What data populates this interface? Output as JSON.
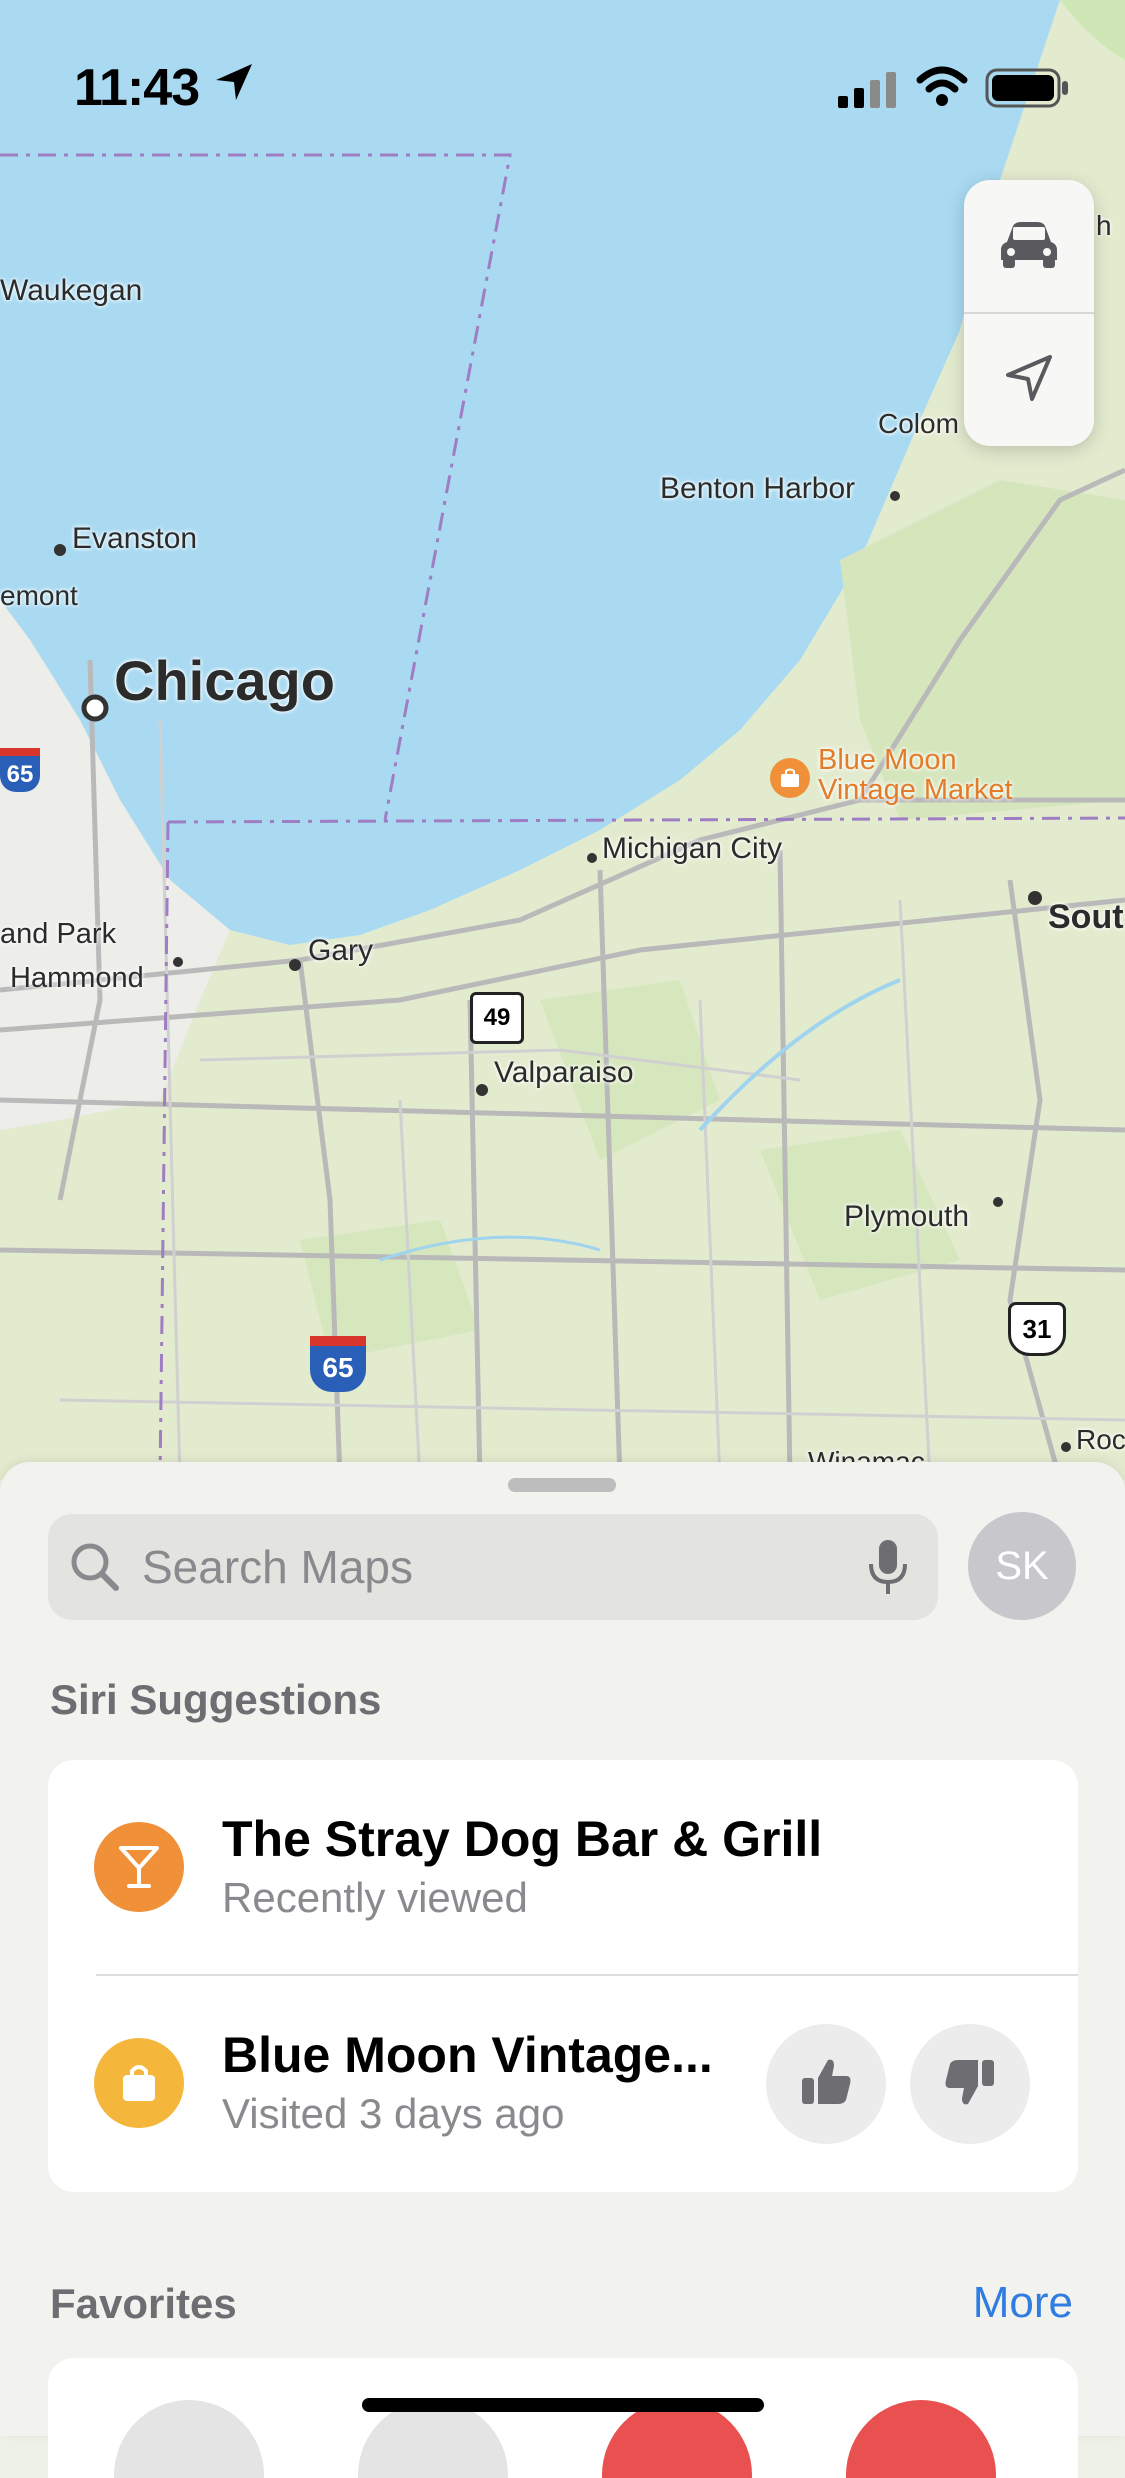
{
  "status_bar": {
    "time": "11:43"
  },
  "map": {
    "labels": {
      "waukegan": "Waukegan",
      "evanston": "Evanston",
      "glenview": "emont",
      "chicago": "Chicago",
      "highland_park": "and Park",
      "hammond": "Hammond",
      "gary": "Gary",
      "michigan_city": "Michigan City",
      "benton_harbor": "Benton Harbor",
      "coloma": "Colom",
      "south_bend": "Sout",
      "valparaiso": "Valparaiso",
      "plymouth": "Plymouth",
      "winamac": "Winamac",
      "rochester": "Roc",
      "north": "h"
    },
    "poi": {
      "blue_moon_line1": "Blue Moon",
      "blue_moon_line2": "Vintage Market"
    },
    "shields": {
      "i65_left": "65",
      "i65_bottom": "65",
      "route_49": "49",
      "us_31": "31"
    },
    "controls": {
      "drive_icon": "car-icon",
      "location_icon": "location-arrow-icon"
    }
  },
  "sheet": {
    "search": {
      "placeholder": "Search Maps"
    },
    "avatar_initials": "SK",
    "siri_title": "Siri Suggestions",
    "suggestions": [
      {
        "title": "The Stray Dog Bar & Grill",
        "subtitle": "Recently viewed",
        "icon": "cocktail-icon",
        "color": "#f0913a"
      },
      {
        "title": "Blue Moon Vintage...",
        "subtitle": "Visited 3 days ago",
        "icon": "shopping-bag-icon",
        "color": "#f5b73b"
      }
    ],
    "favorites_title": "Favorites",
    "favorites_more": "More"
  },
  "colors": {
    "water": "#aadcf4",
    "land": "#e4ecd0",
    "accent": "#2f7de1"
  }
}
